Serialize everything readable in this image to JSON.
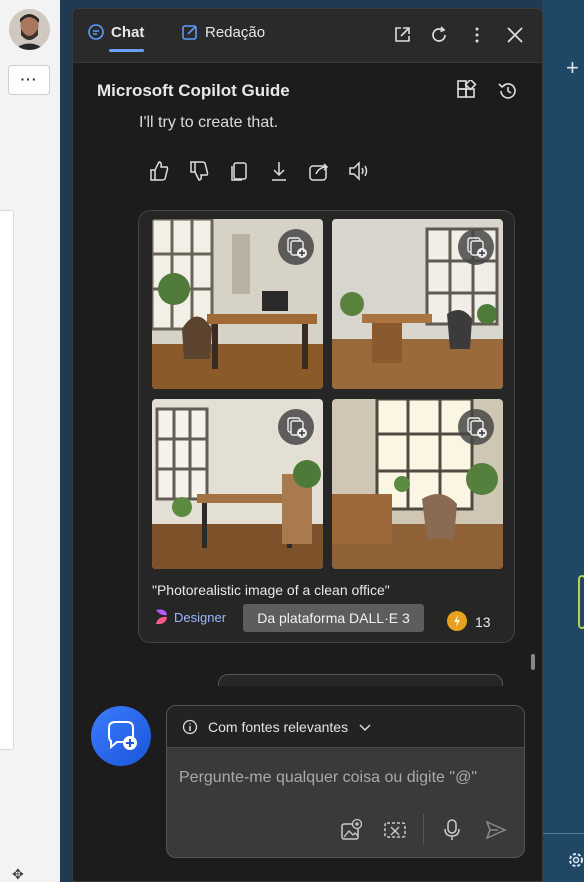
{
  "tabs": [
    {
      "label": "Chat",
      "active": true
    },
    {
      "label": "Redação",
      "active": false
    }
  ],
  "header": {
    "title": "Microsoft Copilot Guide"
  },
  "message": {
    "reply_text": "I'll try to create that.",
    "actions": [
      "thumbs-up-icon",
      "thumbs-down-icon",
      "copy-icon",
      "download-icon",
      "share-icon",
      "read-aloud-icon"
    ]
  },
  "image_card": {
    "prompt": "\"Photorealistic image of a clean office\"",
    "designer_label": "Designer",
    "platform_badge": "Da plataforma DALL·E 3",
    "boost_count": "13"
  },
  "input": {
    "source_selector": "Com fontes relevantes",
    "placeholder": "Pergunte-me qualquer coisa ou digite \"@\""
  },
  "left_strip": {
    "more_label": "···"
  },
  "colors": {
    "accent": "#3c7cff",
    "panel_bg": "#1c1c1c",
    "coin": "#e6a21c"
  }
}
